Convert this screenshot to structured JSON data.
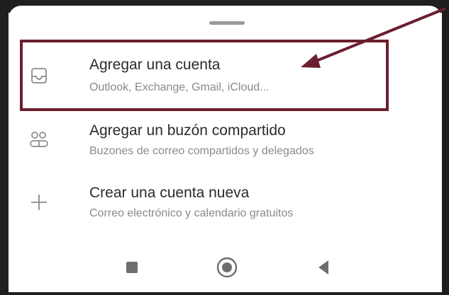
{
  "menu": {
    "items": [
      {
        "title": "Agregar una cuenta",
        "subtitle": "Outlook, Exchange, Gmail, iCloud...",
        "icon": "inbox-icon"
      },
      {
        "title": "Agregar un buzón compartido",
        "subtitle": "Buzones de correo compartidos y delegados",
        "icon": "shared-mailbox-icon"
      },
      {
        "title": "Crear una cuenta nueva",
        "subtitle": "Correo electrónico y calendario gratuitos",
        "icon": "plus-icon"
      }
    ]
  },
  "navigation_bar": {
    "buttons": [
      "recents-square-icon",
      "home-circle-icon",
      "back-triangle-icon"
    ]
  },
  "annotation": {
    "color": "#6b1e2e"
  }
}
